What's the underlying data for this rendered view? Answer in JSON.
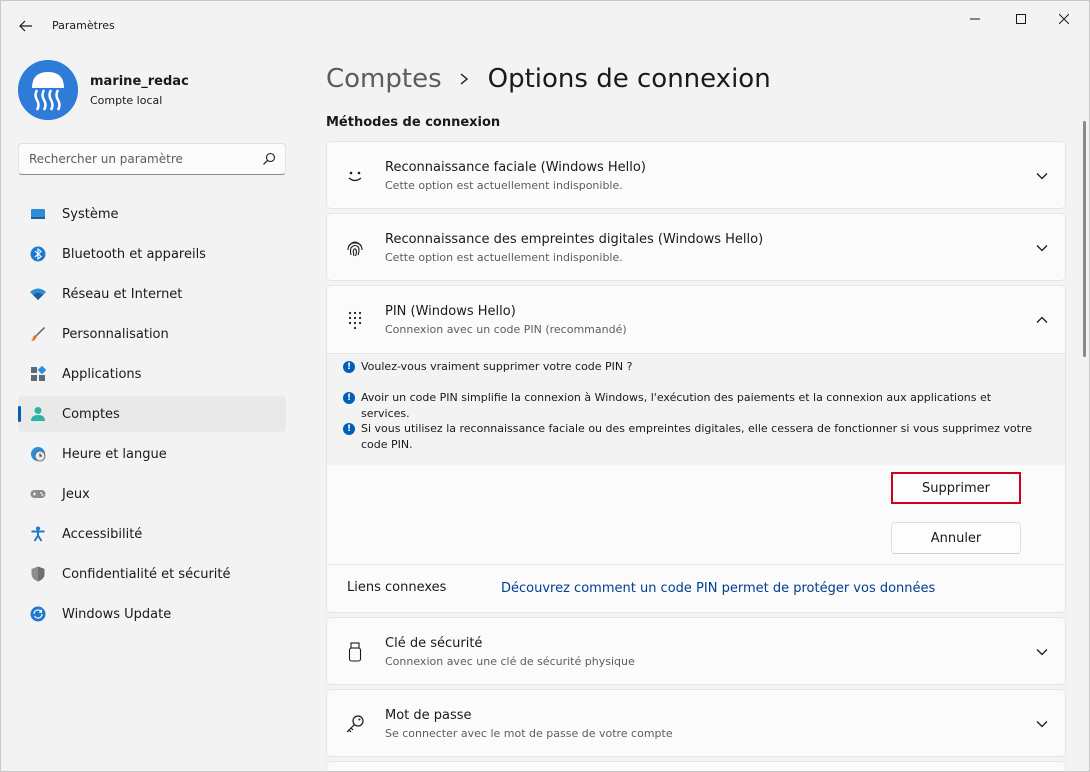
{
  "app": {
    "title": "Paramètres",
    "back_icon": "arrow-left-icon",
    "window_controls": [
      "minimize-icon",
      "maximize-icon",
      "close-icon"
    ]
  },
  "user": {
    "name": "marine_redac",
    "account_type": "Compte local",
    "avatar_color": "#2f7bd8"
  },
  "search": {
    "placeholder": "Rechercher un paramètre",
    "icon": "search-icon"
  },
  "nav": {
    "items": [
      {
        "label": "Système",
        "icon": "monitor-icon",
        "selected": false
      },
      {
        "label": "Bluetooth et appareils",
        "icon": "bluetooth-icon",
        "selected": false
      },
      {
        "label": "Réseau et Internet",
        "icon": "wifi-icon",
        "selected": false
      },
      {
        "label": "Personnalisation",
        "icon": "brush-icon",
        "selected": false
      },
      {
        "label": "Applications",
        "icon": "apps-icon",
        "selected": false
      },
      {
        "label": "Comptes",
        "icon": "person-icon",
        "selected": true
      },
      {
        "label": "Heure et langue",
        "icon": "clock-globe-icon",
        "selected": false
      },
      {
        "label": "Jeux",
        "icon": "gamepad-icon",
        "selected": false
      },
      {
        "label": "Accessibilité",
        "icon": "accessibility-icon",
        "selected": false
      },
      {
        "label": "Confidentialité et sécurité",
        "icon": "shield-icon",
        "selected": false
      },
      {
        "label": "Windows Update",
        "icon": "sync-icon",
        "selected": false
      }
    ]
  },
  "breadcrumb": {
    "parent": "Comptes",
    "current": "Options de connexion"
  },
  "section_title": "Méthodes de connexion",
  "methods": {
    "face": {
      "title": "Reconnaissance faciale (Windows Hello)",
      "subtitle": "Cette option est actuellement indisponible.",
      "icon": "smiley-icon"
    },
    "fingerprint": {
      "title": "Reconnaissance des empreintes digitales (Windows Hello)",
      "subtitle": "Cette option est actuellement indisponible.",
      "icon": "fingerprint-icon"
    },
    "pin": {
      "title": "PIN (Windows Hello)",
      "subtitle": "Connexion avec un code PIN (recommandé)",
      "icon": "keypad-icon",
      "expanded": true,
      "info": [
        "Voulez-vous vraiment supprimer votre code PIN ?",
        "Avoir un code PIN simplifie la connexion à Windows, l'exécution des paiements et la connexion aux applications et services.",
        "Si vous utilisez la reconnaissance faciale ou des empreintes digitales, elle cessera de fonctionner si vous supprimez votre code PIN."
      ],
      "delete_label": "Supprimer",
      "cancel_label": "Annuler",
      "related_label": "Liens connexes",
      "related_link": "Découvrez comment un code PIN permet de protéger vos données"
    },
    "security_key": {
      "title": "Clé de sécurité",
      "subtitle": "Connexion avec une clé de sécurité physique",
      "icon": "usb-key-icon"
    },
    "password": {
      "title": "Mot de passe",
      "subtitle": "Se connecter avec le mot de passe de votre compte",
      "icon": "key-icon"
    }
  },
  "colors": {
    "accent": "#005fb8",
    "link": "#003e92",
    "highlight_box": "#d0021b"
  }
}
